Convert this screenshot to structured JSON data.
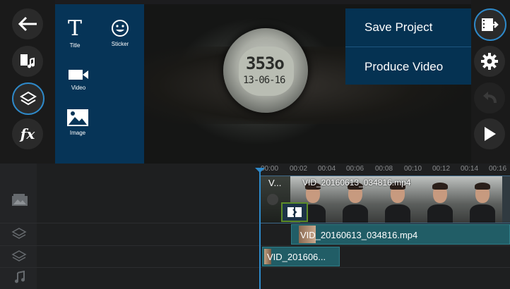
{
  "left_toolbar": {
    "buttons": [
      {
        "name": "back",
        "icon": "back-arrow-icon"
      },
      {
        "name": "media",
        "icon": "media-library-icon"
      },
      {
        "name": "layers",
        "icon": "layers-icon",
        "active": true
      },
      {
        "name": "effects",
        "icon": "fx-icon",
        "label": "fx"
      }
    ]
  },
  "media_panel": {
    "items": [
      {
        "label": "Title",
        "icon": "title-text-icon",
        "glyph": "T"
      },
      {
        "label": "Sticker",
        "icon": "sticker-smiley-icon"
      },
      {
        "label": "Video",
        "icon": "video-camera-icon"
      },
      {
        "label": "Image",
        "icon": "image-icon"
      }
    ]
  },
  "preview": {
    "watch_time": "353o",
    "watch_date": "13-06-16"
  },
  "menu": {
    "items": [
      {
        "label": "Save Project"
      },
      {
        "label": "Produce Video"
      }
    ]
  },
  "right_toolbar": {
    "buttons": [
      {
        "name": "export",
        "icon": "export-film-icon",
        "active": true
      },
      {
        "name": "settings",
        "icon": "gear-icon"
      },
      {
        "name": "undo",
        "icon": "undo-icon",
        "disabled": true
      },
      {
        "name": "play",
        "icon": "play-icon"
      }
    ]
  },
  "timeline": {
    "ticks": [
      "00:00",
      "00:02",
      "00:04",
      "00:06",
      "00:08",
      "00:10",
      "00:12",
      "00:14",
      "00:16"
    ],
    "tracks": [
      {
        "icon": "video-track-icon"
      },
      {
        "icon": "layer-track-icon"
      },
      {
        "icon": "layer-track-icon"
      },
      {
        "icon": "audio-track-icon"
      }
    ],
    "main_clip": {
      "short_label": "V...",
      "label": "VID_20160613_034816.mp4"
    },
    "overlay_clip": {
      "label": "VID_20160613_034816.mp4"
    },
    "small_clip": {
      "label": "VID_201606..."
    }
  },
  "colors": {
    "accent": "#2e89c9",
    "panel": "#063457",
    "menu": "#053252",
    "clip_teal": "#215d66",
    "transition_border": "#5c8c28"
  }
}
